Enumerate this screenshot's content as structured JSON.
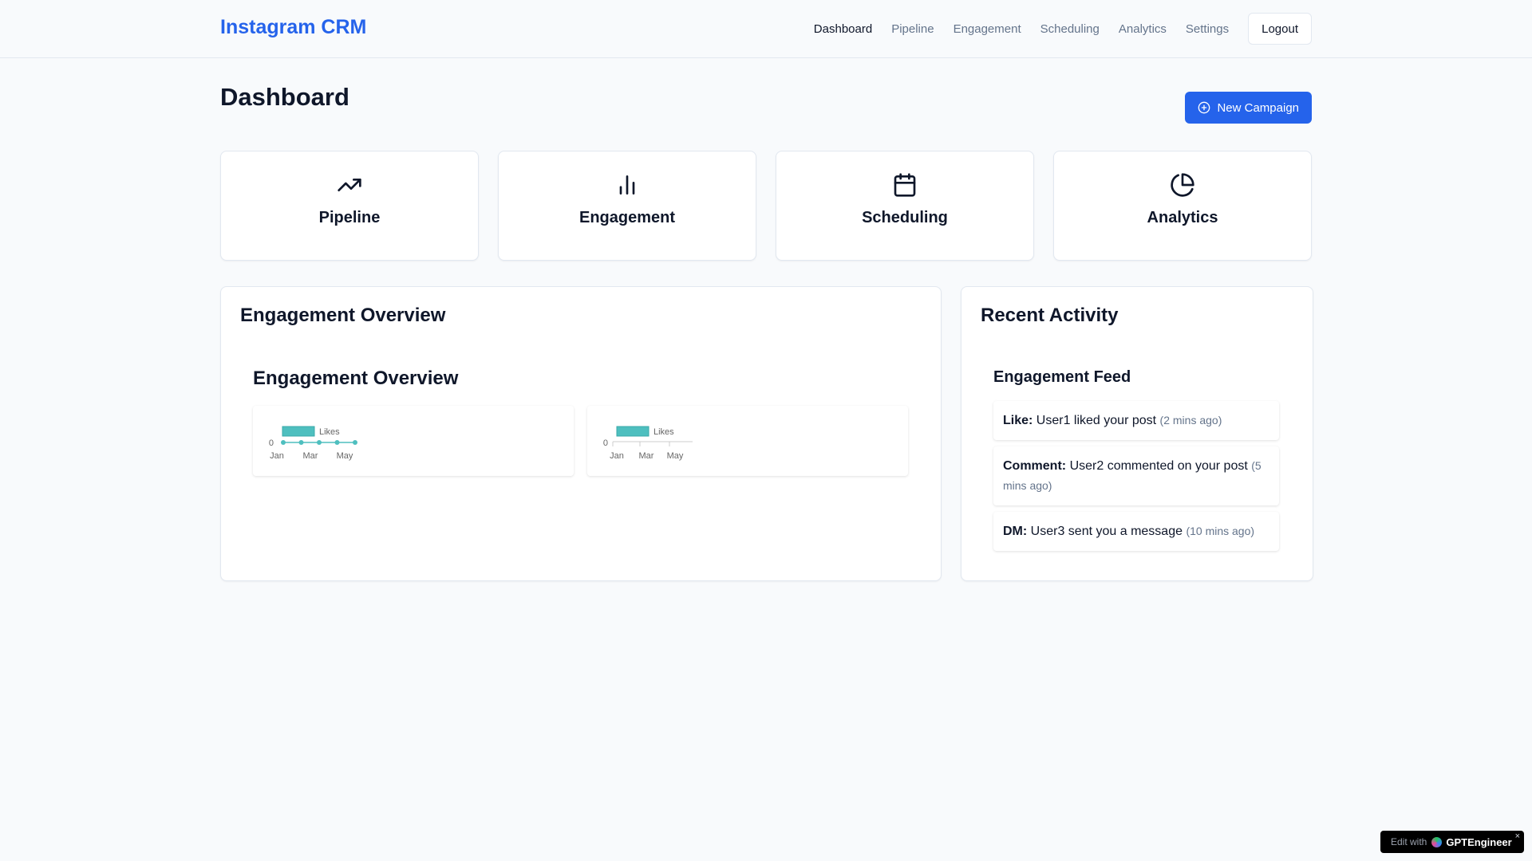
{
  "header": {
    "brand": "Instagram CRM",
    "nav": [
      "Dashboard",
      "Pipeline",
      "Engagement",
      "Scheduling",
      "Analytics",
      "Settings"
    ],
    "logout_label": "Logout"
  },
  "page": {
    "title": "Dashboard",
    "new_campaign_label": "New Campaign"
  },
  "cards": [
    {
      "label": "Pipeline",
      "icon": "trending-up-icon"
    },
    {
      "label": "Engagement",
      "icon": "bar-chart-icon"
    },
    {
      "label": "Scheduling",
      "icon": "calendar-icon"
    },
    {
      "label": "Analytics",
      "icon": "pie-chart-icon"
    }
  ],
  "overview": {
    "title": "Engagement Overview",
    "subtitle": "Engagement Overview"
  },
  "chart_data": [
    {
      "type": "line",
      "x": [
        "Jan",
        "Mar",
        "May"
      ],
      "x_points": 5,
      "series": [
        {
          "name": "Likes",
          "values": [
            0,
            0,
            0,
            0,
            0
          ],
          "color": "#4ebfbf"
        }
      ],
      "y_ticks": [
        "0"
      ],
      "legend": "top"
    },
    {
      "type": "bar",
      "x": [
        "Jan",
        "Mar",
        "May"
      ],
      "series": [
        {
          "name": "Likes",
          "values": [
            0,
            0,
            0
          ],
          "color": "#4ebfbf"
        }
      ],
      "y_ticks": [
        "0"
      ],
      "legend": "top"
    }
  ],
  "activity": {
    "title": "Recent Activity",
    "feed_title": "Engagement Feed",
    "items": [
      {
        "kind": "Like:",
        "text": "User1 liked your post",
        "time": "(2 mins ago)"
      },
      {
        "kind": "Comment:",
        "text": "User2 commented on your post",
        "time": "(5 mins ago)"
      },
      {
        "kind": "DM:",
        "text": "User3 sent you a message",
        "time": "(10 mins ago)"
      }
    ]
  },
  "badge": {
    "edit_label": "Edit with",
    "brand": "GPTEngineer",
    "close": "×"
  }
}
